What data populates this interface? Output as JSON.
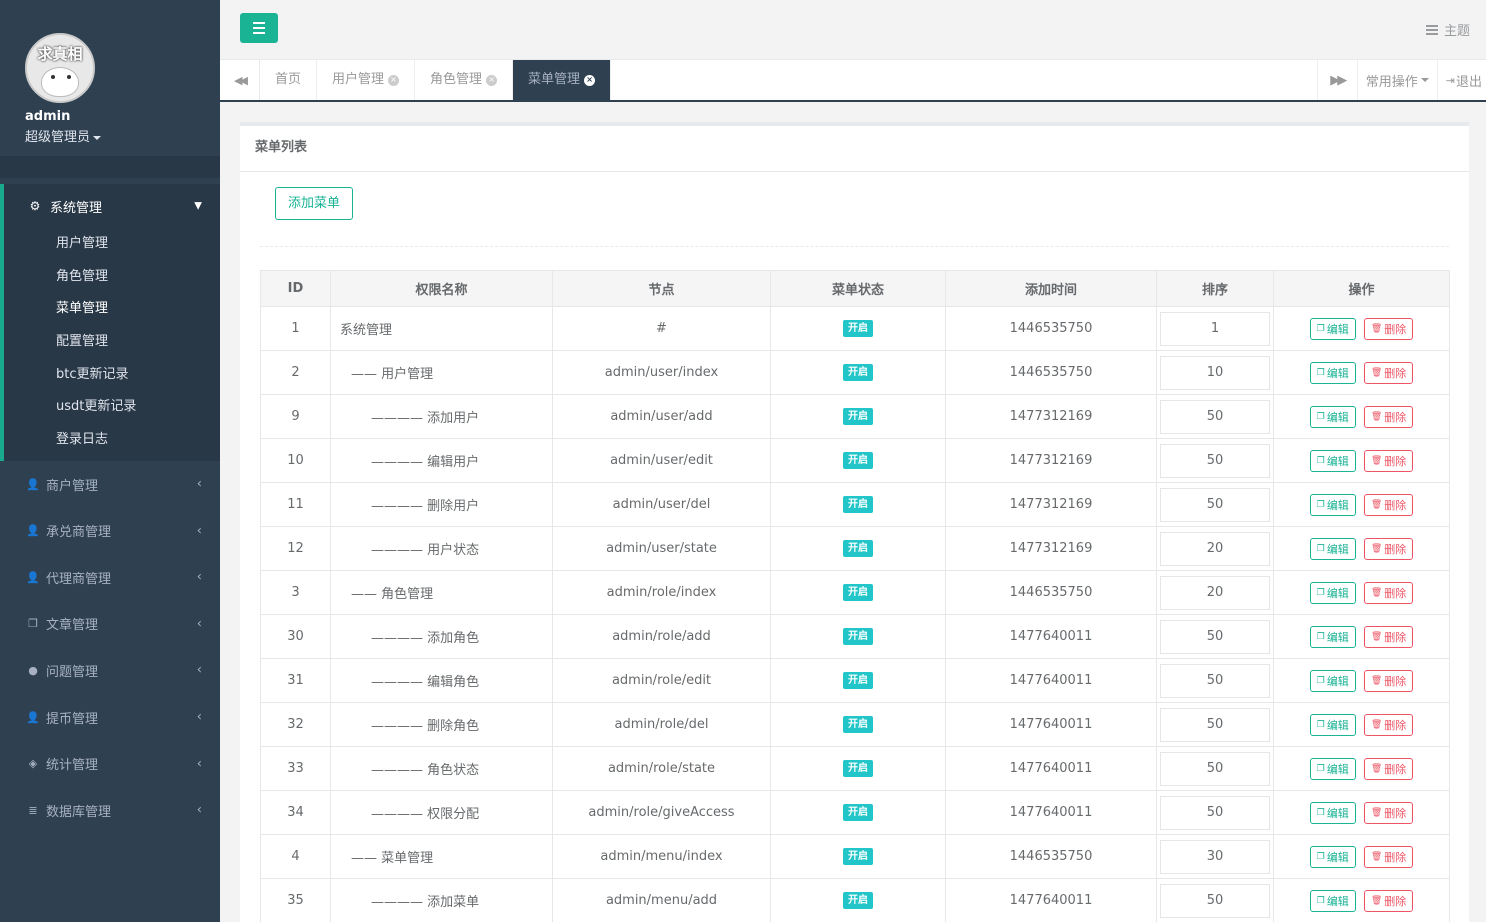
{
  "profile": {
    "avatar_text": "求真相",
    "name": "admin",
    "role": "超级管理员"
  },
  "sidebar": {
    "active_group": {
      "label": "系统管理",
      "icon": "gear-icon",
      "items": [
        "用户管理",
        "角色管理",
        "菜单管理",
        "配置管理",
        "btc更新记录",
        "usdt更新记录",
        "登录日志"
      ],
      "current": "菜单管理"
    },
    "groups": [
      {
        "label": "商户管理",
        "icon": "user-icon",
        "glyph": "👤"
      },
      {
        "label": "承兑商管理",
        "icon": "user-icon",
        "glyph": "👤"
      },
      {
        "label": "代理商管理",
        "icon": "user-icon",
        "glyph": "👤"
      },
      {
        "label": "文章管理",
        "icon": "copy-icon",
        "glyph": "❐"
      },
      {
        "label": "问题管理",
        "icon": "comment-icon",
        "glyph": "●"
      },
      {
        "label": "提币管理",
        "icon": "user-icon",
        "glyph": "👤"
      },
      {
        "label": "统计管理",
        "icon": "cube-icon",
        "glyph": "◈"
      },
      {
        "label": "数据库管理",
        "icon": "database-icon",
        "glyph": "≣"
      }
    ]
  },
  "header": {
    "theme_label": "主题"
  },
  "tabs": {
    "items": [
      {
        "label": "首页",
        "closable": false,
        "active": false
      },
      {
        "label": "用户管理",
        "closable": true,
        "active": false
      },
      {
        "label": "角色管理",
        "closable": true,
        "active": false
      },
      {
        "label": "菜单管理",
        "closable": true,
        "active": true
      }
    ],
    "ops_label": "常用操作",
    "logout_label": "退出"
  },
  "panel": {
    "title": "菜单列表",
    "add_button": "添加菜单"
  },
  "table": {
    "columns": [
      "ID",
      "权限名称",
      "节点",
      "菜单状态",
      "添加时间",
      "排序",
      "操作"
    ],
    "status_label": "开启",
    "edit_label": "编辑",
    "delete_label": "删除",
    "rows": [
      {
        "id": "1",
        "name": "系统管理",
        "node": "#",
        "time": "1446535750",
        "sort": "1"
      },
      {
        "id": "2",
        "name": "—— 用户管理",
        "node": "admin/user/index",
        "time": "1446535750",
        "sort": "10"
      },
      {
        "id": "9",
        "name": "———— 添加用户",
        "node": "admin/user/add",
        "time": "1477312169",
        "sort": "50"
      },
      {
        "id": "10",
        "name": "———— 编辑用户",
        "node": "admin/user/edit",
        "time": "1477312169",
        "sort": "50"
      },
      {
        "id": "11",
        "name": "———— 删除用户",
        "node": "admin/user/del",
        "time": "1477312169",
        "sort": "50"
      },
      {
        "id": "12",
        "name": "———— 用户状态",
        "node": "admin/user/state",
        "time": "1477312169",
        "sort": "20"
      },
      {
        "id": "3",
        "name": "—— 角色管理",
        "node": "admin/role/index",
        "time": "1446535750",
        "sort": "20"
      },
      {
        "id": "30",
        "name": "———— 添加角色",
        "node": "admin/role/add",
        "time": "1477640011",
        "sort": "50"
      },
      {
        "id": "31",
        "name": "———— 编辑角色",
        "node": "admin/role/edit",
        "time": "1477640011",
        "sort": "50"
      },
      {
        "id": "32",
        "name": "———— 删除角色",
        "node": "admin/role/del",
        "time": "1477640011",
        "sort": "50"
      },
      {
        "id": "33",
        "name": "———— 角色状态",
        "node": "admin/role/state",
        "time": "1477640011",
        "sort": "50"
      },
      {
        "id": "34",
        "name": "———— 权限分配",
        "node": "admin/role/giveAccess",
        "time": "1477640011",
        "sort": "50"
      },
      {
        "id": "4",
        "name": "—— 菜单管理",
        "node": "admin/menu/index",
        "time": "1446535750",
        "sort": "30"
      },
      {
        "id": "35",
        "name": "———— 添加菜单",
        "node": "admin/menu/add",
        "time": "1477640011",
        "sort": "50"
      }
    ]
  },
  "colors": {
    "sidebar_bg": "#2f4050",
    "primary": "#1ab394",
    "info": "#23c6c8",
    "danger": "#ed5565"
  }
}
